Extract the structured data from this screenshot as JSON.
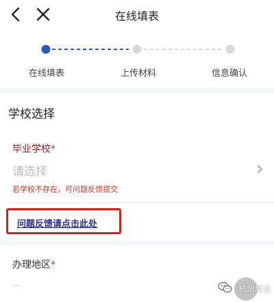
{
  "header": {
    "title": "在线填表"
  },
  "steps": [
    {
      "label": "在线填表",
      "state": "active"
    },
    {
      "label": "上传材料",
      "state": "pending"
    },
    {
      "label": "信息确认",
      "state": "pending"
    }
  ],
  "colors": {
    "accent": "#2f5bb8",
    "pending": "#d8d8d8",
    "required": "#c0392b",
    "highlight_border": "#d6201b",
    "link": "#2d2f8f"
  },
  "section": {
    "title": "学校选择"
  },
  "school_field": {
    "label": "毕业学校",
    "required_mark": "*",
    "placeholder": "请选择",
    "hint": "若学校不存在，可问题反馈提交"
  },
  "feedback": {
    "link_text": "问题反馈请点击此处"
  },
  "region_field": {
    "label": "办理地区",
    "required_mark": "*",
    "value": "--"
  },
  "watermark": {
    "text": "杭州就业"
  },
  "icons": [
    "back-arrow-icon",
    "close-icon",
    "chevron-right-icon",
    "wechat-icon"
  ]
}
